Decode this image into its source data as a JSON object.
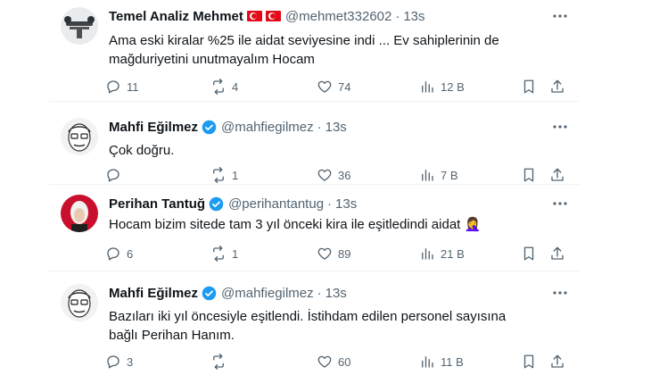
{
  "tweets": [
    {
      "name": "Temel Analiz Mehmet",
      "handle": "@mehmet332602",
      "dot": "·",
      "time": "13s",
      "flags": 2,
      "verified": false,
      "text": "Ama eski kiralar %25 ile aidat seviyesine indi ... Ev sahiplerinin de mağduriyetini unutmayalım Hocam",
      "replies": "11",
      "retweets": "4",
      "likes": "74",
      "views": "12 B",
      "avatar_icon": "drone-photo-avatar"
    },
    {
      "name": "Mahfi Eğilmez",
      "handle": "@mahfiegilmez",
      "dot": "·",
      "time": "13s",
      "flags": 0,
      "verified": true,
      "text": "Çok doğru.",
      "replies": "",
      "retweets": "1",
      "likes": "36",
      "views": "7 B",
      "avatar_icon": "portrait-sketch-avatar"
    },
    {
      "name": "Perihan Tantuğ",
      "handle": "@perihantantug",
      "dot": "·",
      "time": "13s",
      "flags": 0,
      "verified": true,
      "text": "Hocam bizim sitede tam 3 yıl önceki kira ile eşitledindi aidat",
      "emoji": "🤦‍♀️",
      "replies": "6",
      "retweets": "1",
      "likes": "89",
      "views": "21 B",
      "avatar_icon": "woman-photo-avatar"
    },
    {
      "name": "Mahfi Eğilmez",
      "handle": "@mahfiegilmez",
      "dot": "·",
      "time": "13s",
      "flags": 0,
      "verified": true,
      "text": "Bazıları iki yıl öncesiyle eşitlendi. İstihdam edilen personel sayısına bağlı Perihan Hanım.",
      "replies": "3",
      "retweets": "",
      "likes": "60",
      "views": "11 B",
      "avatar_icon": "portrait-sketch-avatar"
    }
  ],
  "colors": {
    "text": "#0f1419",
    "muted": "#536471",
    "verified": "#1d9bf0",
    "flag": "#e30a17"
  }
}
